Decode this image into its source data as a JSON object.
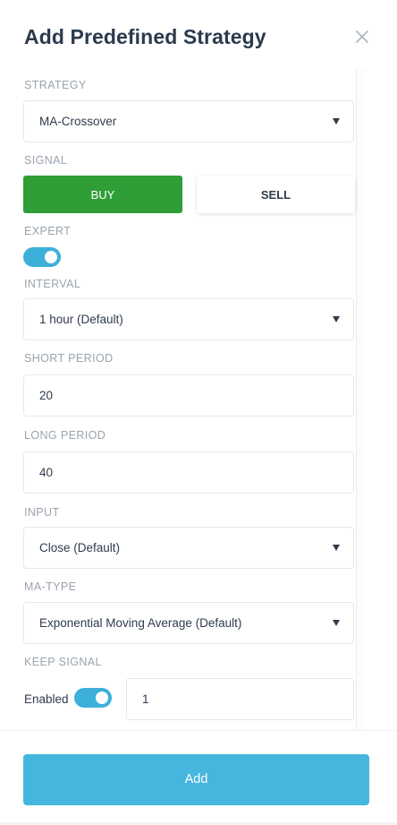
{
  "dialog": {
    "title": "Add Predefined Strategy",
    "close_icon": "close-icon"
  },
  "colors": {
    "buy": "#2f9e36",
    "toggle": "#3cb0d9",
    "add_button": "#45b6dd",
    "label": "#9aa3ad"
  },
  "fields": {
    "strategy": {
      "label": "STRATEGY",
      "value": "MA-Crossover"
    },
    "signal": {
      "label": "SIGNAL",
      "buy": "BUY",
      "sell": "SELL",
      "selected": "BUY"
    },
    "expert": {
      "label": "EXPERT",
      "on": true
    },
    "interval": {
      "label": "INTERVAL",
      "value": "1 hour (Default)"
    },
    "short_period": {
      "label": "SHORT PERIOD",
      "value": "20"
    },
    "long_period": {
      "label": "LONG PERIOD",
      "value": "40"
    },
    "input": {
      "label": "INPUT",
      "value": "Close (Default)"
    },
    "ma_type": {
      "label": "MA-TYPE",
      "value": "Exponential Moving Average (Default)"
    },
    "keep_signal": {
      "label": "KEEP SIGNAL",
      "enabled_label": "Enabled",
      "enabled": true,
      "value": "1"
    }
  },
  "actions": {
    "add": "Add"
  }
}
